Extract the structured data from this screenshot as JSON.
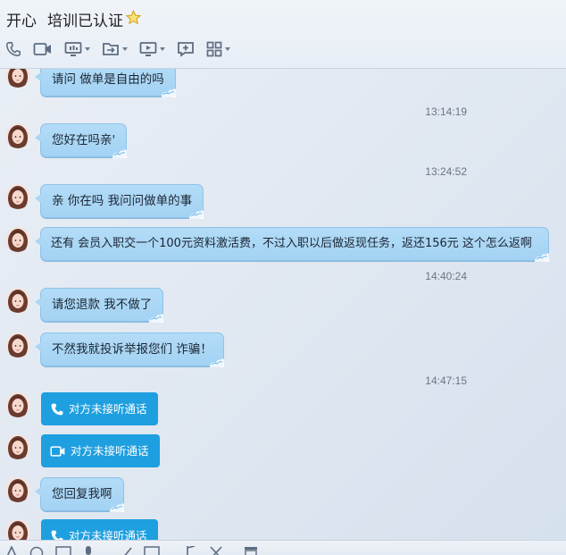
{
  "header": {
    "contact_name": "开心",
    "status": "培训已认证"
  },
  "toolbar": {
    "icons": [
      "phone-icon",
      "video-icon",
      "screen-share-icon",
      "file-transfer-icon",
      "remote-desktop-icon",
      "add-app-icon",
      "apps-grid-icon"
    ]
  },
  "messages": [
    {
      "type": "text",
      "text": "请问 做单是自由的吗"
    },
    {
      "type": "timestamp",
      "text": "13:14:19"
    },
    {
      "type": "text",
      "text": "您好在吗亲'"
    },
    {
      "type": "timestamp",
      "text": "13:24:52"
    },
    {
      "type": "text",
      "text": "亲 你在吗 我问问做单的事"
    },
    {
      "type": "text",
      "text": "还有 会员入职交一个100元资料激活费，不过入职以后做返现任务，返还156元 这个怎么返啊"
    },
    {
      "type": "timestamp",
      "text": "14:40:24"
    },
    {
      "type": "text",
      "text": "请您退款 我不做了"
    },
    {
      "type": "text",
      "text": "不然我就投诉举报您们 诈骗！"
    },
    {
      "type": "timestamp",
      "text": "14:47:15"
    },
    {
      "type": "call",
      "icon": "phone-icon",
      "text": "对方未接听通话"
    },
    {
      "type": "call",
      "icon": "video-icon",
      "text": "对方未接听通话"
    },
    {
      "type": "text",
      "text": "您回复我啊"
    },
    {
      "type": "call",
      "icon": "phone-icon",
      "text": "对方未接听通话"
    }
  ],
  "colors": {
    "bubble": "#a9d6f5",
    "call_card": "#1e9fe0",
    "timestamp": "#6c7684"
  }
}
